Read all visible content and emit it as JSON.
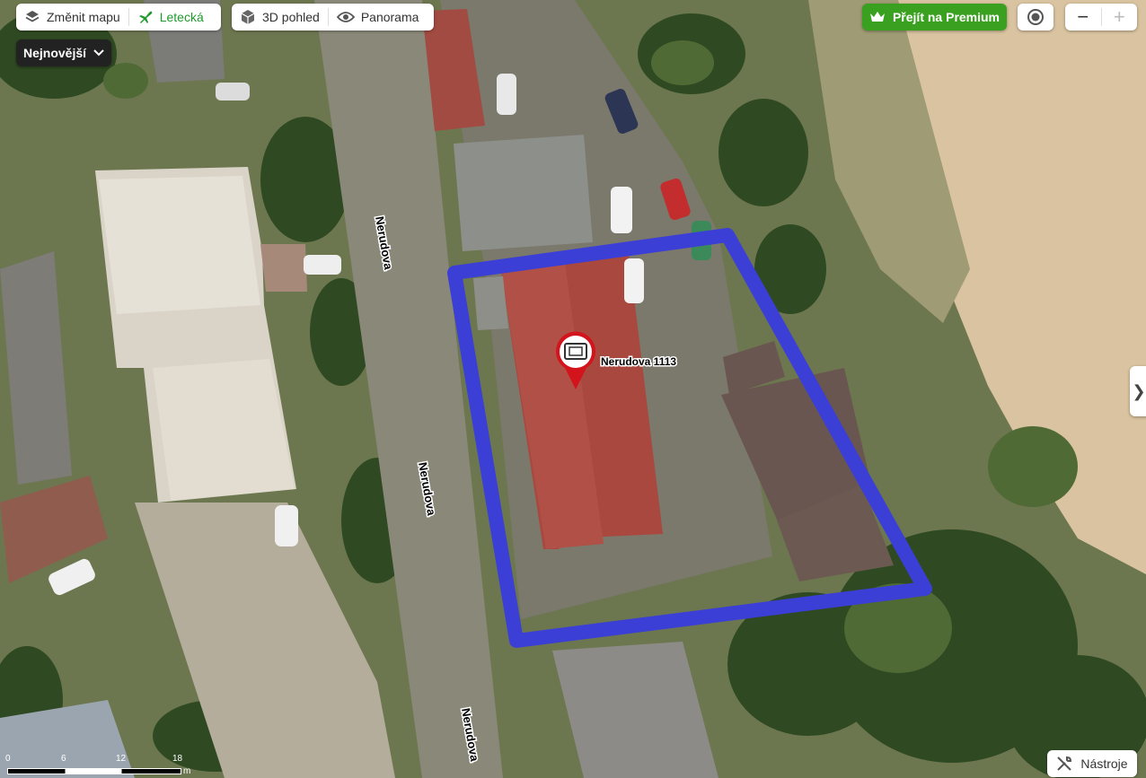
{
  "toolbar": {
    "change_map_label": "Změnit mapu",
    "aerial_label": "Letecká",
    "view3d_label": "3D pohled",
    "panorama_label": "Panorama",
    "active_color": "#1f9a2a"
  },
  "layer_dropdown": {
    "label": "Nejnovější"
  },
  "premium": {
    "label": "Přejít na Premium",
    "color": "#3aa020"
  },
  "zoom": {
    "minus": "−",
    "plus": "+"
  },
  "side_panel": {
    "label": "❯"
  },
  "tools": {
    "label": "Nástroje"
  },
  "map": {
    "streets": [
      "Nerudova",
      "Nerudova",
      "Nerudova"
    ],
    "marker": {
      "label": "Nerudova 1113",
      "color": "#d4141c"
    },
    "outline_color": "#3b3fd6"
  },
  "scale": {
    "ticks": [
      "0",
      "6",
      "12",
      "18"
    ],
    "unit": "m"
  }
}
